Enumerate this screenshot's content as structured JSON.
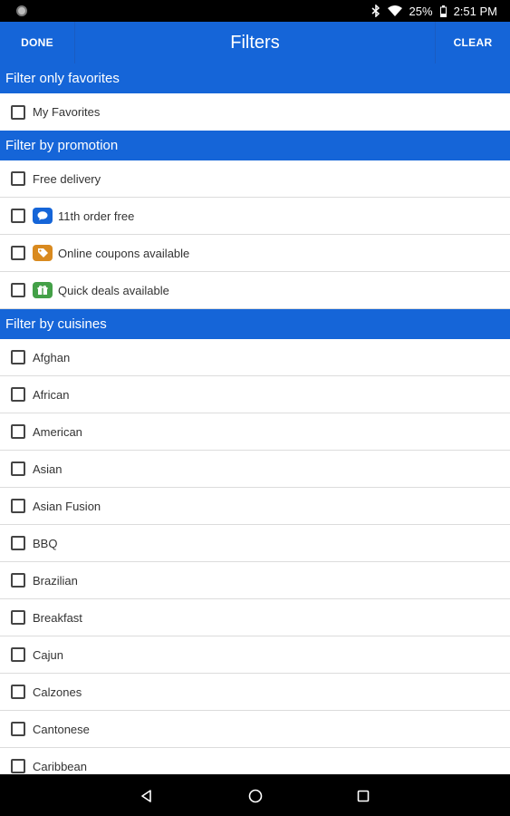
{
  "status_bar": {
    "battery": "25%",
    "time": "2:51 PM"
  },
  "app_bar": {
    "done_label": "DONE",
    "title": "Filters",
    "clear_label": "CLEAR",
    "color": "#1565d8"
  },
  "sections": {
    "favorites": {
      "title": "Filter only favorites",
      "items": [
        {
          "label": "My Favorites"
        }
      ]
    },
    "promotion": {
      "title": "Filter by promotion",
      "items": [
        {
          "label": "Free delivery"
        },
        {
          "label": "11th order free",
          "icon": "chat-bubble-icon",
          "icon_color": "#1565d8"
        },
        {
          "label": "Online coupons available",
          "icon": "coupon-tag-icon",
          "icon_color": "#d98a1f"
        },
        {
          "label": "Quick deals available",
          "icon": "gift-icon",
          "icon_color": "#43a047"
        }
      ]
    },
    "cuisines": {
      "title": "Filter by cuisines",
      "items": [
        {
          "label": "Afghan"
        },
        {
          "label": "African"
        },
        {
          "label": "American"
        },
        {
          "label": "Asian"
        },
        {
          "label": "Asian Fusion"
        },
        {
          "label": "BBQ"
        },
        {
          "label": "Brazilian"
        },
        {
          "label": "Breakfast"
        },
        {
          "label": "Cajun"
        },
        {
          "label": "Calzones"
        },
        {
          "label": "Cantonese"
        },
        {
          "label": "Caribbean"
        }
      ]
    }
  },
  "nav_bar": {
    "icons": [
      "back-icon",
      "home-icon",
      "recents-icon"
    ]
  }
}
